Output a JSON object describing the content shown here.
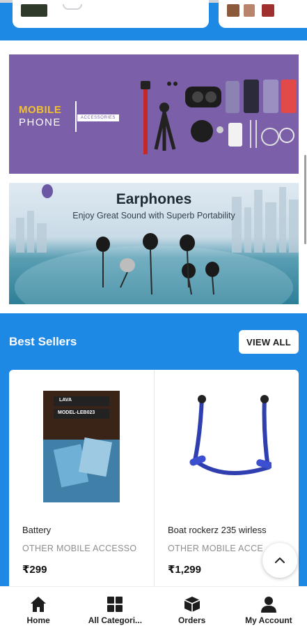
{
  "banners": {
    "mobile": {
      "title": "MOBILE",
      "subtitle": "PHONE",
      "tag": "ACCESSORIES"
    },
    "earphones": {
      "title": "Earphones",
      "subtitle": "Enjoy Great Sound with Superb Portability"
    }
  },
  "best_sellers": {
    "title": "Best Sellers",
    "view_all_label": "VIEW ALL",
    "products": [
      {
        "name": "Battery",
        "category": "OTHER MOBILE ACCESSO",
        "price": "₹299",
        "image_text_1": "LAVA",
        "image_text_2": "MODEL-LEB023"
      },
      {
        "name": "Boat rockerz 235 wirless",
        "category": "OTHER MOBILE ACCE",
        "price": "₹1,299"
      }
    ]
  },
  "bottom_nav": {
    "items": [
      {
        "label": "Home",
        "icon": "home-icon"
      },
      {
        "label": "All Categori...",
        "icon": "grid-icon"
      },
      {
        "label": "Orders",
        "icon": "box-icon"
      },
      {
        "label": "My Account",
        "icon": "person-icon"
      }
    ]
  },
  "colors": {
    "primary": "#1e88e5",
    "banner_purple": "#7b5fa8",
    "accent_yellow": "#f1c230"
  }
}
